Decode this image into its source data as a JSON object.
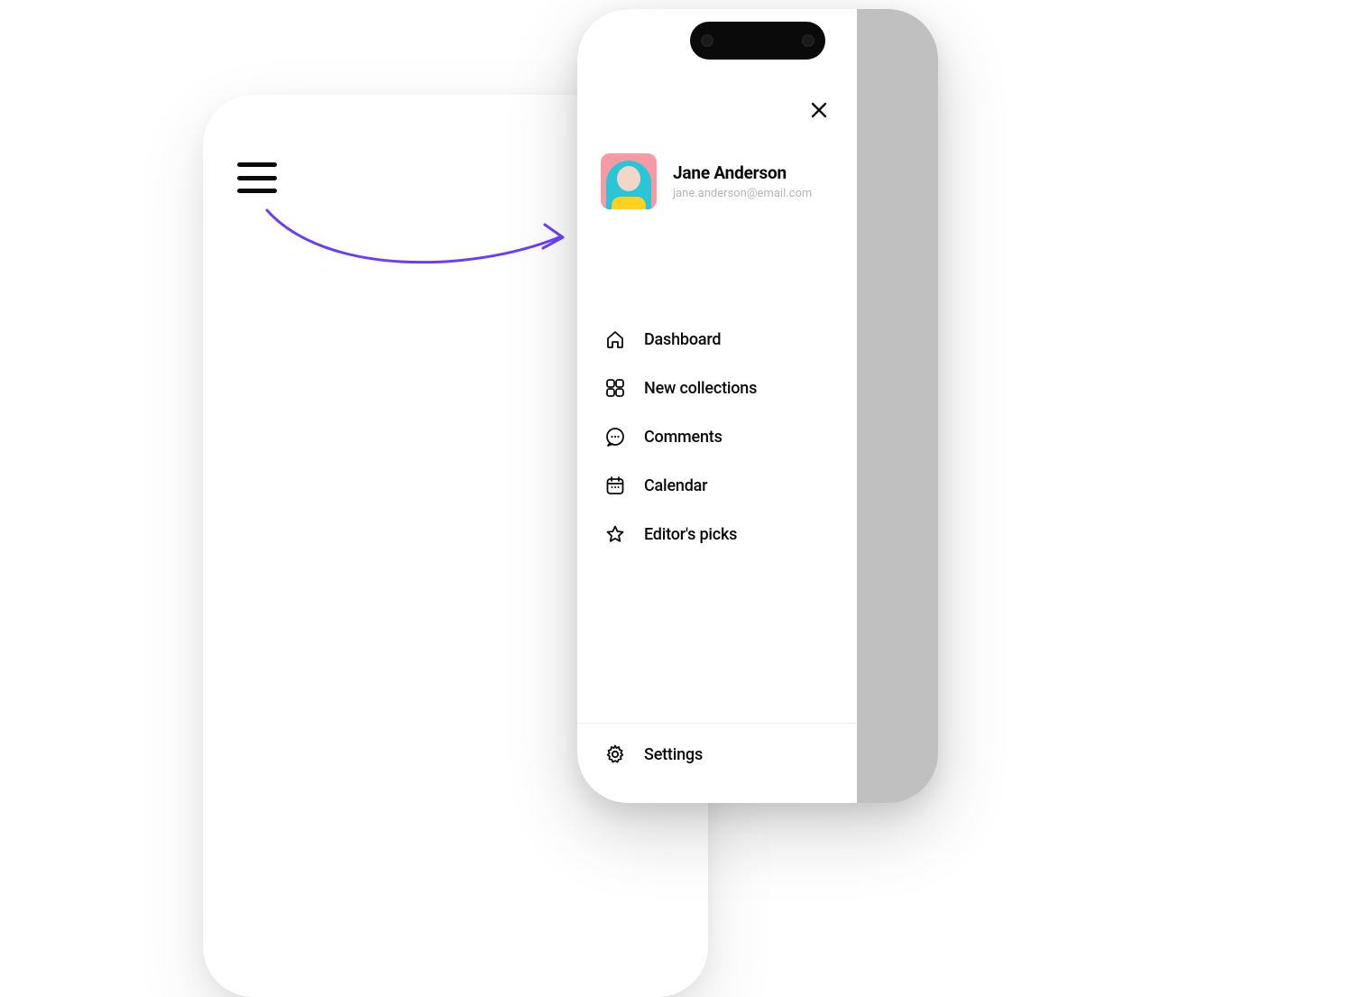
{
  "colors": {
    "accent_arrow": "#6b3cff",
    "text_primary": "#0a0a0a",
    "text_muted": "#b6b6b6",
    "avatar_bg": "#f79aa6"
  },
  "profile": {
    "name": "Jane Anderson",
    "email": "jane.anderson@email.com"
  },
  "menu": {
    "items": [
      {
        "icon": "home-icon",
        "label": "Dashboard"
      },
      {
        "icon": "grid-icon",
        "label": "New collections"
      },
      {
        "icon": "comment-icon",
        "label": "Comments"
      },
      {
        "icon": "calendar-icon",
        "label": "Calendar"
      },
      {
        "icon": "star-icon",
        "label": "Editor's picks"
      }
    ]
  },
  "footer": {
    "settings_label": "Settings"
  }
}
